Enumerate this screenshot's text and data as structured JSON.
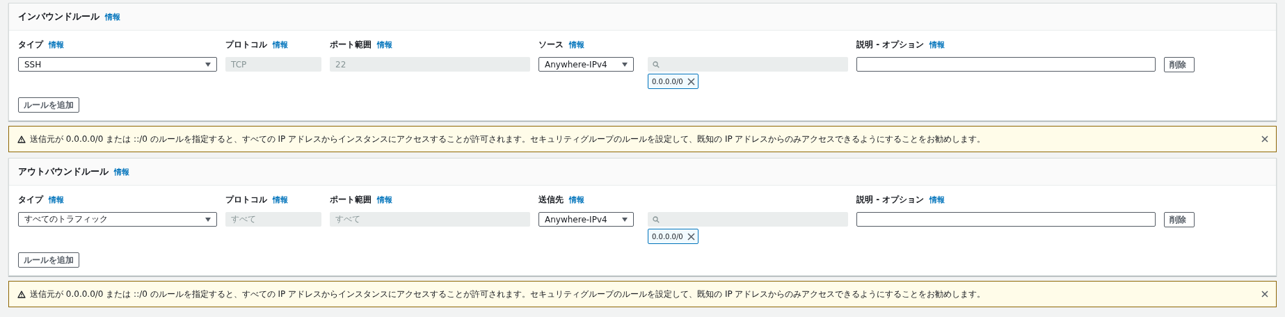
{
  "blocks": [
    {
      "kind": "rules",
      "title": "インバウンドルール",
      "info": "情報",
      "columns": [
        {
          "label": "タイプ",
          "info": "情報"
        },
        {
          "label": "プロトコル",
          "info": "情報"
        },
        {
          "label": "ポート範囲",
          "info": "情報"
        },
        {
          "label": "ソース",
          "info": "情報"
        },
        {
          "label": "説明 - オプション",
          "info": "情報"
        }
      ],
      "rules": [
        {
          "type": "SSH",
          "protocol": {
            "value": "TCP",
            "disabled": true
          },
          "port": {
            "value": "22",
            "disabled": true
          },
          "source": "Anywhere-IPv4",
          "chips": [
            "0.0.0.0/0"
          ],
          "delete": "削除"
        }
      ],
      "add_button": "ルールを追加"
    },
    {
      "kind": "alert",
      "text": "送信元が 0.0.0.0/0 または ::/0 のルールを指定すると、すべての IP アドレスからインスタンスにアクセスすることが許可されます。セキュリティグループのルールを設定して、既知の IP アドレスからのみアクセスできるようにすることをお勧めします。"
    },
    {
      "kind": "rules",
      "title": "アウトバウンドルール",
      "info": "情報",
      "columns": [
        {
          "label": "タイプ",
          "info": "情報"
        },
        {
          "label": "プロトコル",
          "info": "情報"
        },
        {
          "label": "ポート範囲",
          "info": "情報"
        },
        {
          "label": "送信先",
          "info": "情報"
        },
        {
          "label": "説明 - オプション",
          "info": "情報"
        }
      ],
      "rules": [
        {
          "type": "すべてのトラフィック",
          "protocol": {
            "value": "すべて",
            "disabled": true
          },
          "port": {
            "value": "すべて",
            "disabled": true
          },
          "source": "Anywhere-IPv4",
          "chips": [
            "0.0.0.0/0"
          ],
          "delete": "削除"
        }
      ],
      "add_button": "ルールを追加"
    },
    {
      "kind": "alert",
      "text": "送信元が 0.0.0.0/0 または ::/0 のルールを指定すると、すべての IP アドレスからインスタンスにアクセスすることが許可されます。セキュリティグループのルールを設定して、既知の IP アドレスからのみアクセスできるようにすることをお勧めします。"
    }
  ]
}
